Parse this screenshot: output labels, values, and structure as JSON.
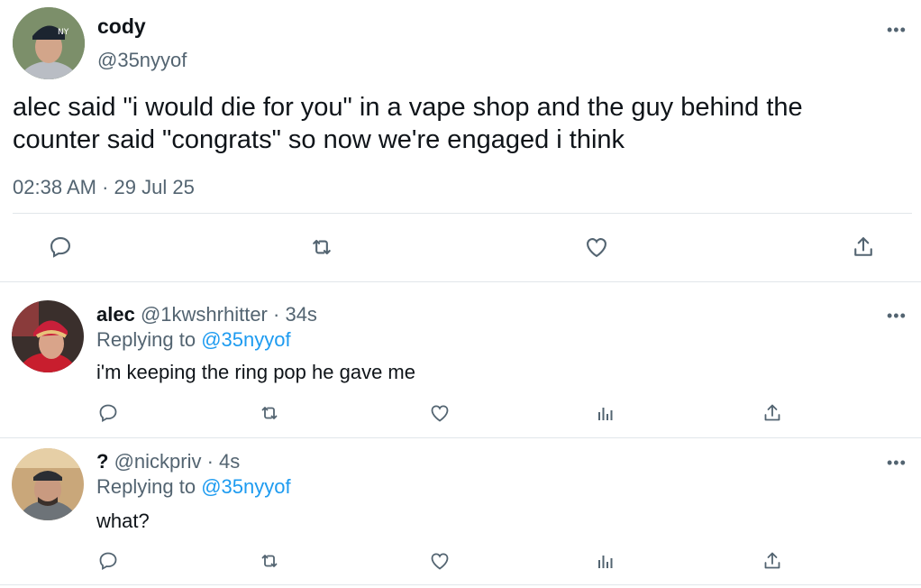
{
  "main_tweet": {
    "display_name": "cody",
    "handle": "@35nyyof",
    "text_line1": "alec said \"i would die for you\" in a vape shop and the guy behind the",
    "text_line2": "counter said \"congrats\" so now we're engaged i think",
    "time": "02:38 AM",
    "date_sep": "·",
    "date": "29 Jul 25",
    "more": "•••"
  },
  "replies": [
    {
      "display_name": "alec",
      "handle": "@1kwshrhitter",
      "age": "· 34s",
      "replying_prefix": "Replying to",
      "replying_handle": "@35nyyof",
      "text": "i'm keeping the ring pop he gave me",
      "more": "•••"
    },
    {
      "display_name": "?",
      "handle": "@nickpriv",
      "age": "· 4s",
      "replying_prefix": "Replying to",
      "replying_handle": "@35nyyof",
      "text": "what?",
      "more": "•••"
    }
  ],
  "icons": {
    "reply": "reply-icon",
    "retweet": "retweet-icon",
    "like": "like-icon",
    "views": "views-icon",
    "share": "share-icon",
    "more": "more-icon"
  },
  "colors": {
    "text": "#0f1419",
    "secondary": "#536471",
    "link": "#1d9bf0",
    "divider": "#e1e6ea"
  }
}
